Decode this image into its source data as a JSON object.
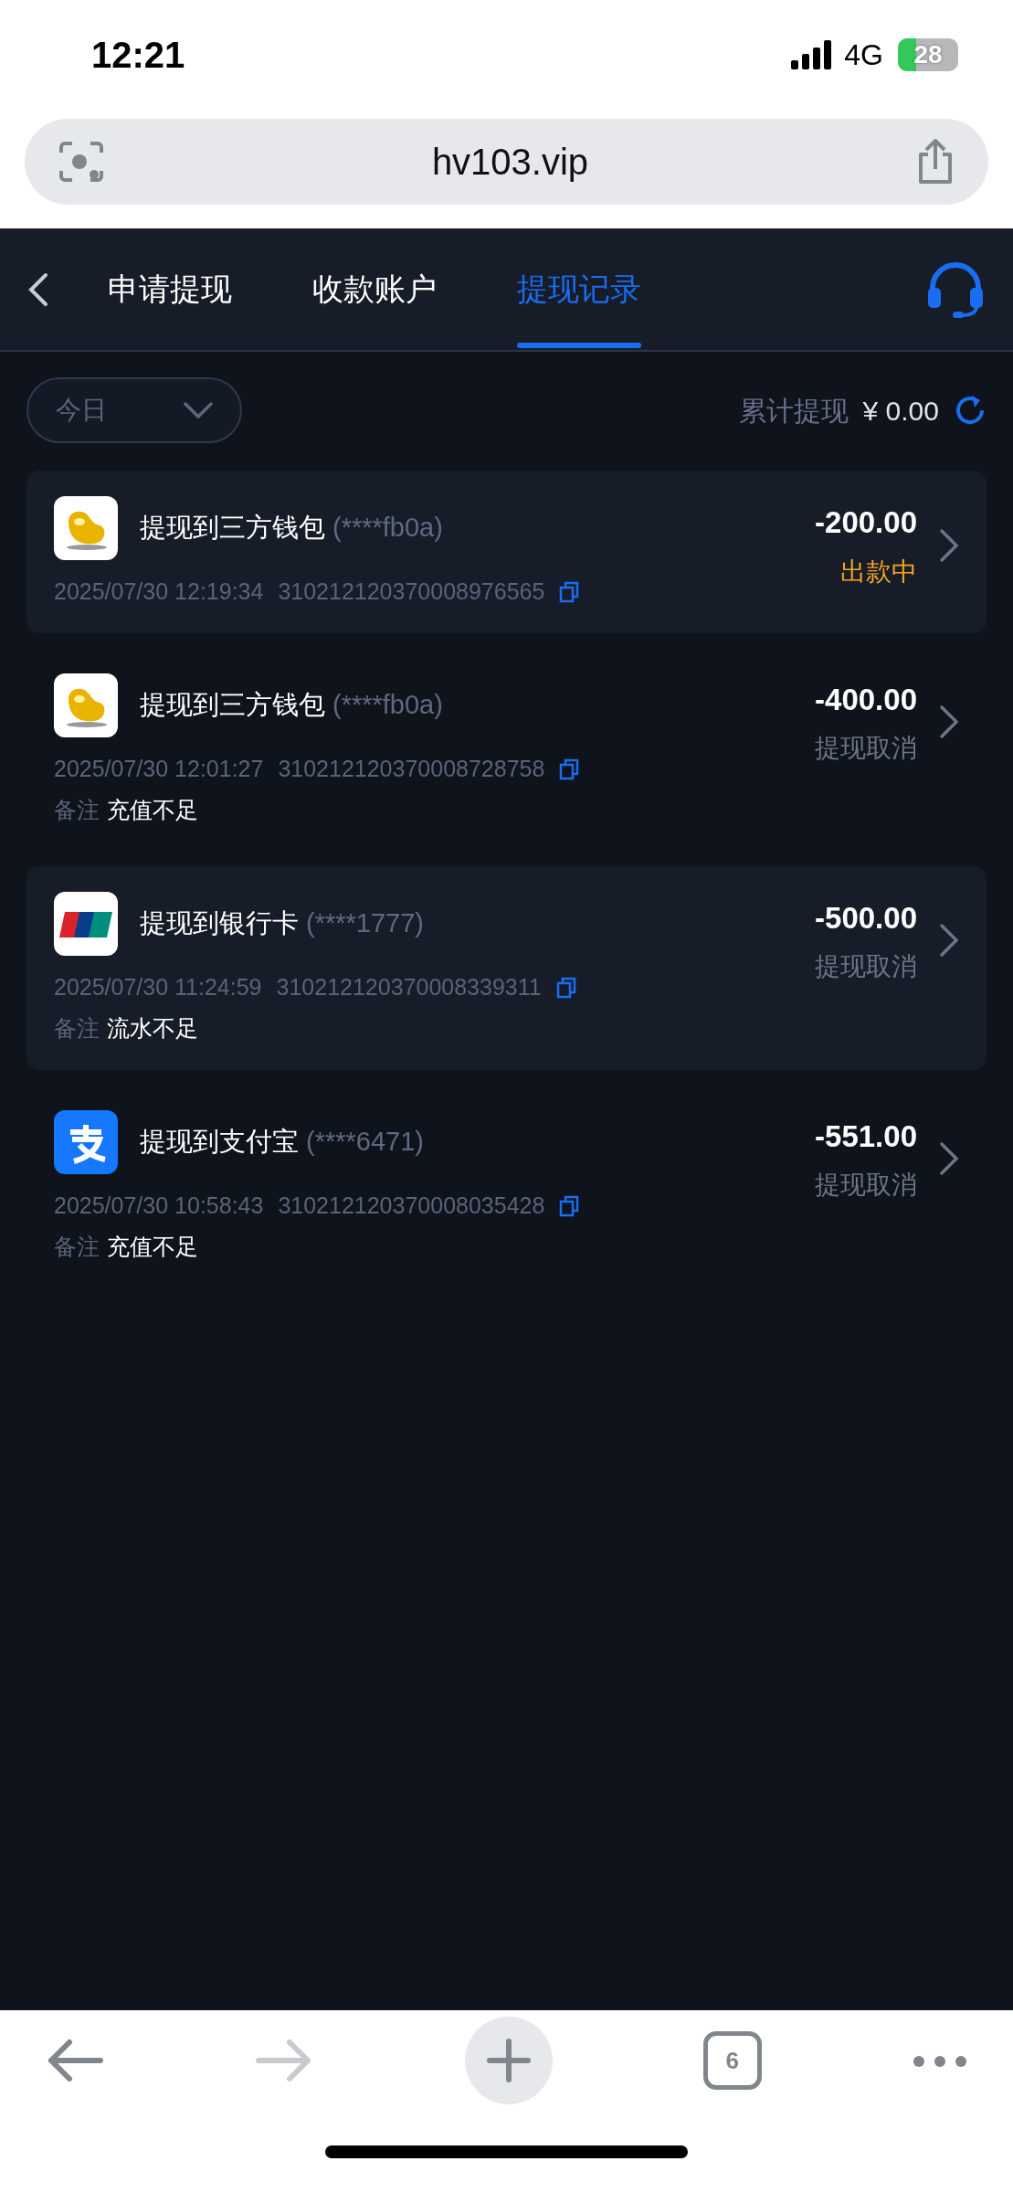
{
  "status_bar": {
    "time": "12:21",
    "network": "4G",
    "battery": "28"
  },
  "address_bar": {
    "url": "hv103.vip"
  },
  "header": {
    "tabs": [
      {
        "label": "申请提现",
        "selected": false
      },
      {
        "label": "收款账户",
        "selected": false
      },
      {
        "label": "提现记录",
        "selected": true
      }
    ]
  },
  "filter": {
    "period": "今日",
    "total_label": "累计提现",
    "total_value": "¥ 0.00"
  },
  "records": [
    {
      "kind": "wallet",
      "title": "提现到三方钱包",
      "account": "(****fb0a)",
      "time": "2025/07/30 12:19:34",
      "order": "310212120370008976565",
      "amount": "-200.00",
      "status": "出款中",
      "processing": true,
      "shaded": true
    },
    {
      "kind": "wallet",
      "title": "提现到三方钱包",
      "account": "(****fb0a)",
      "time": "2025/07/30 12:01:27",
      "order": "310212120370008728758",
      "amount": "-400.00",
      "status": "提现取消",
      "processing": false,
      "note_label": "备注",
      "note": "充值不足",
      "shaded": false
    },
    {
      "kind": "bank",
      "title": "提现到银行卡",
      "account": "(****1777)",
      "time": "2025/07/30 11:24:59",
      "order": "310212120370008339311",
      "amount": "-500.00",
      "status": "提现取消",
      "processing": false,
      "note_label": "备注",
      "note": "流水不足",
      "shaded": true
    },
    {
      "kind": "alipay",
      "title": "提现到支付宝",
      "account": "(****6471)",
      "time": "2025/07/30 10:58:43",
      "order": "310212120370008035428",
      "amount": "-551.00",
      "status": "提现取消",
      "processing": false,
      "note_label": "备注",
      "note": "充值不足",
      "shaded": false
    }
  ],
  "toolbar": {
    "back": {
      "disabled": false
    },
    "forward": {
      "disabled": true
    },
    "tab_count": "6"
  }
}
